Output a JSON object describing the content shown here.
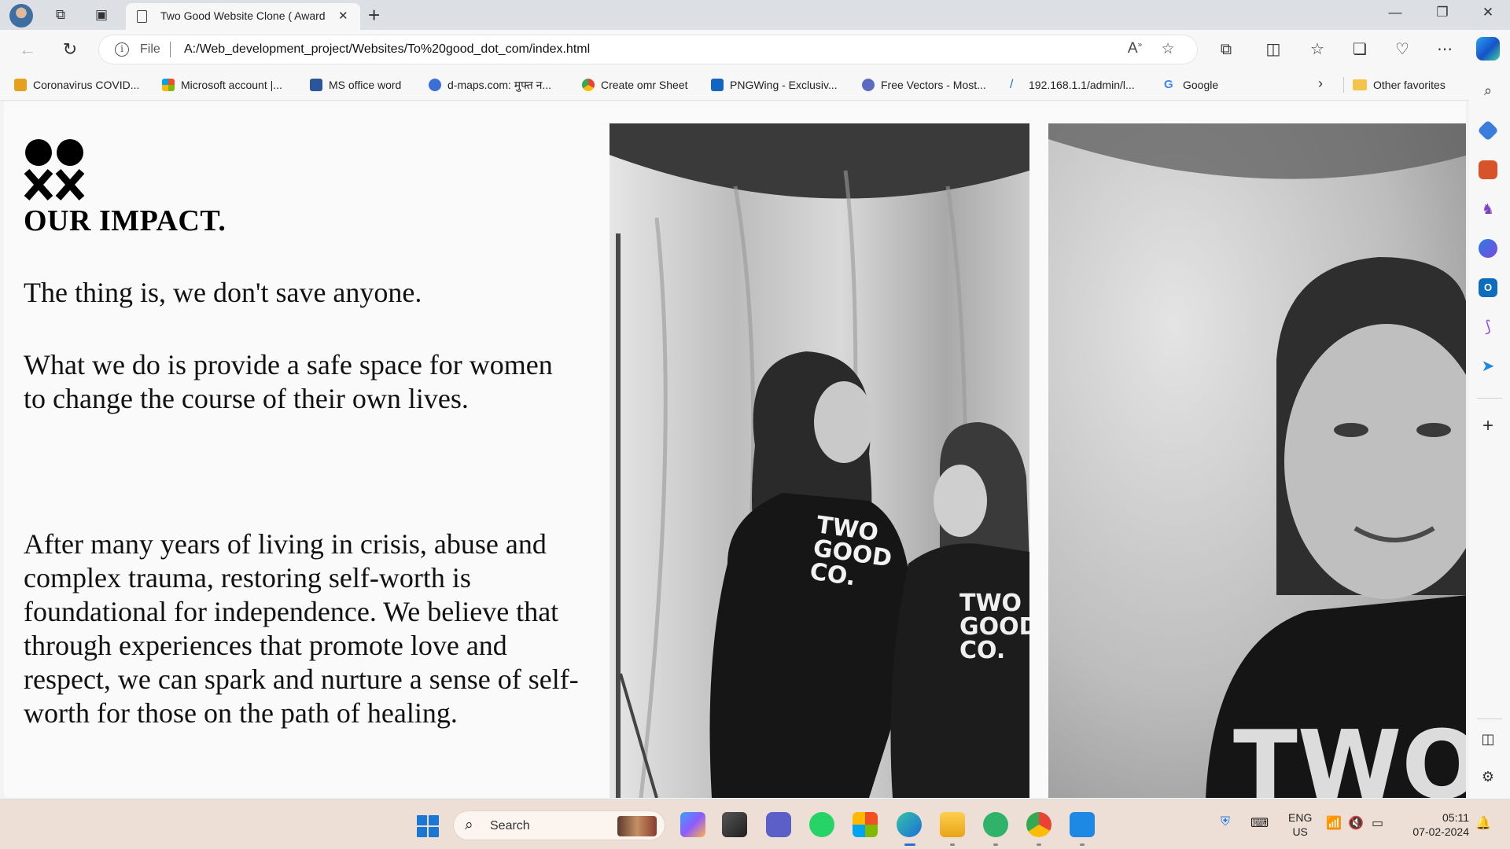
{
  "browser": {
    "tab_title": "Two Good Website Clone ( Award",
    "url_scheme": "File",
    "url": "A:/Web_development_project/Websites/To%20good_dot_com/index.html",
    "favorites": [
      {
        "label": "Coronavirus COVID...",
        "icon": "covid-favicon",
        "color": "#e5a11d"
      },
      {
        "label": "Microsoft account |...",
        "icon": "microsoft-favicon",
        "color": "#f25022"
      },
      {
        "label": "MS office word",
        "icon": "word-favicon",
        "color": "#2b579a"
      },
      {
        "label": "d-maps.com: मुफ्त न...",
        "icon": "dmaps-favicon",
        "color": "#3b6fd6"
      },
      {
        "label": "Create omr Sheet",
        "icon": "omr-favicon",
        "color": "#34a853"
      },
      {
        "label": "PNGWing - Exclusiv...",
        "icon": "pngwing-favicon",
        "color": "#1565c0"
      },
      {
        "label": "Free Vectors - Most...",
        "icon": "vecteezy-favicon",
        "color": "#5c6bc0"
      },
      {
        "label": "192.168.1.1/admin/l...",
        "icon": "router-favicon",
        "color": "#1976d2"
      },
      {
        "label": "Google",
        "icon": "google-favicon",
        "color": "#4285f4"
      }
    ],
    "other_favorites": "Other favorites"
  },
  "page": {
    "cutoff_text": "...",
    "heading": "OUR IMPACT.",
    "para1": "The thing is, we don't save anyone.",
    "para2_line1": "What we do is provide a safe space for women",
    "para2_line2": "to change the course of their own lives.",
    "para3": "After many years of living in crisis, abuse and complex trauma, restoring self-worth is foundational for independence. We believe that through experiences that promote love and respect, we can spark and nurture a sense of self-worth for those on the path of healing.",
    "photo1_shirt_text": "TWO GOOD CO.",
    "photo2_shirt_text": "TWO"
  },
  "taskbar": {
    "search_placeholder": "Search",
    "language_line1": "ENG",
    "language_line2": "US",
    "time": "05:11",
    "date": "07-02-2024"
  }
}
